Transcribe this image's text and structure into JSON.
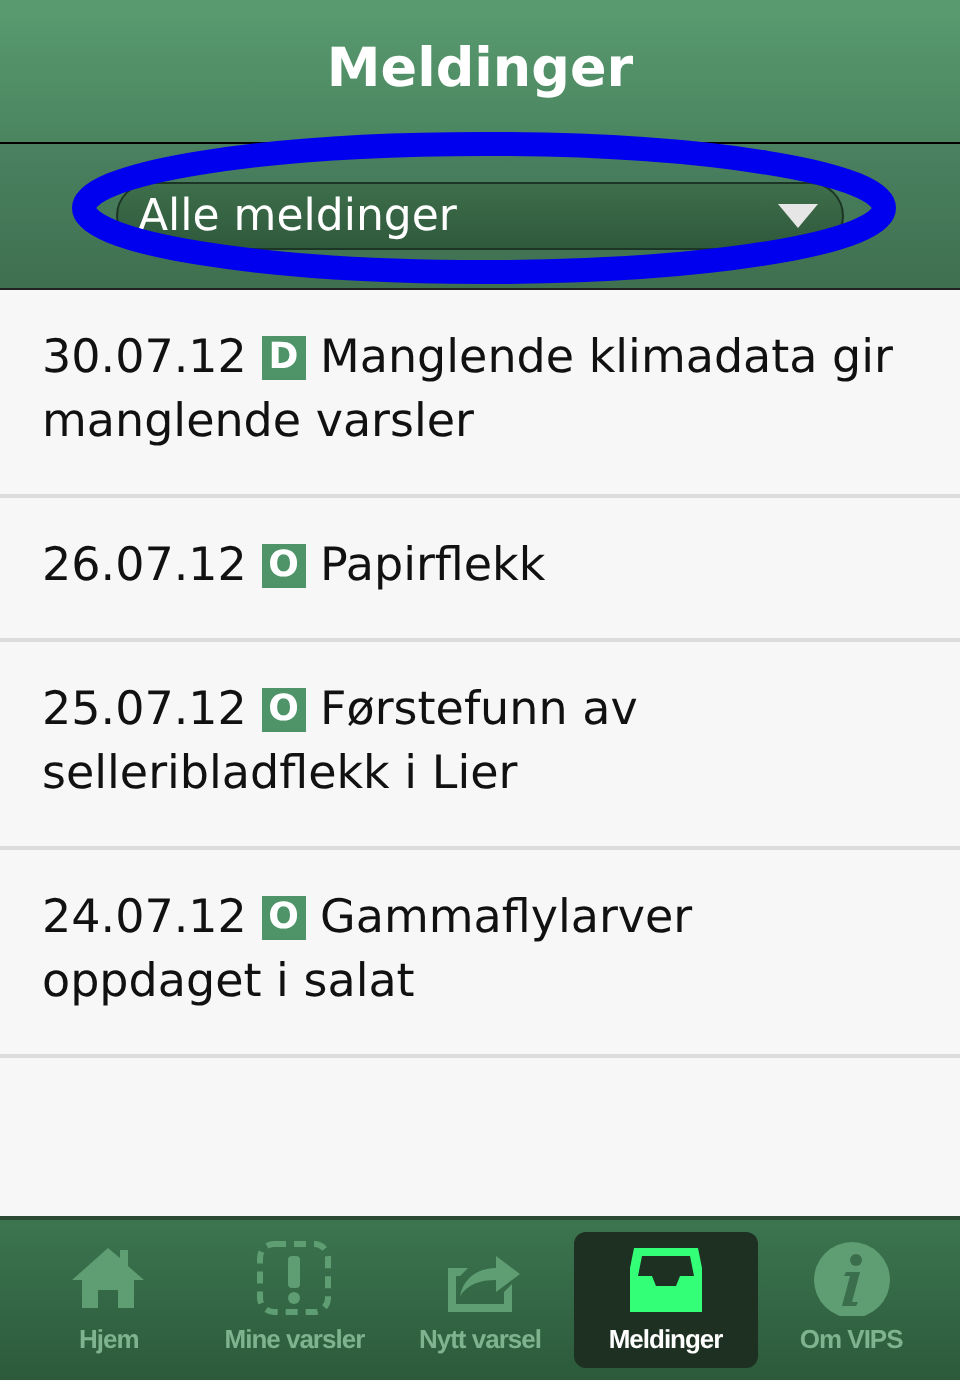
{
  "header": {
    "title": "Meldinger"
  },
  "filter": {
    "value": "Alle meldinger"
  },
  "messages": [
    {
      "date": "30.07.12",
      "badge": "D",
      "title": "Manglende klimadata gir manglende varsler"
    },
    {
      "date": "26.07.12",
      "badge": "O",
      "title": "Papirflekk"
    },
    {
      "date": "25.07.12",
      "badge": "O",
      "title": "Førstefunn av selleribladflekk i Lier"
    },
    {
      "date": "24.07.12",
      "badge": "O",
      "title": "Gammaflylarver oppdaget i salat"
    }
  ],
  "nav": [
    {
      "kind": "home",
      "label": "Hjem",
      "selected": false
    },
    {
      "kind": "alerts",
      "label": "Mine varsler",
      "selected": false
    },
    {
      "kind": "share",
      "label": "Nytt varsel",
      "selected": false
    },
    {
      "kind": "inbox",
      "label": "Meldinger",
      "selected": true
    },
    {
      "kind": "info",
      "label": "Om VIPS",
      "selected": false
    }
  ]
}
